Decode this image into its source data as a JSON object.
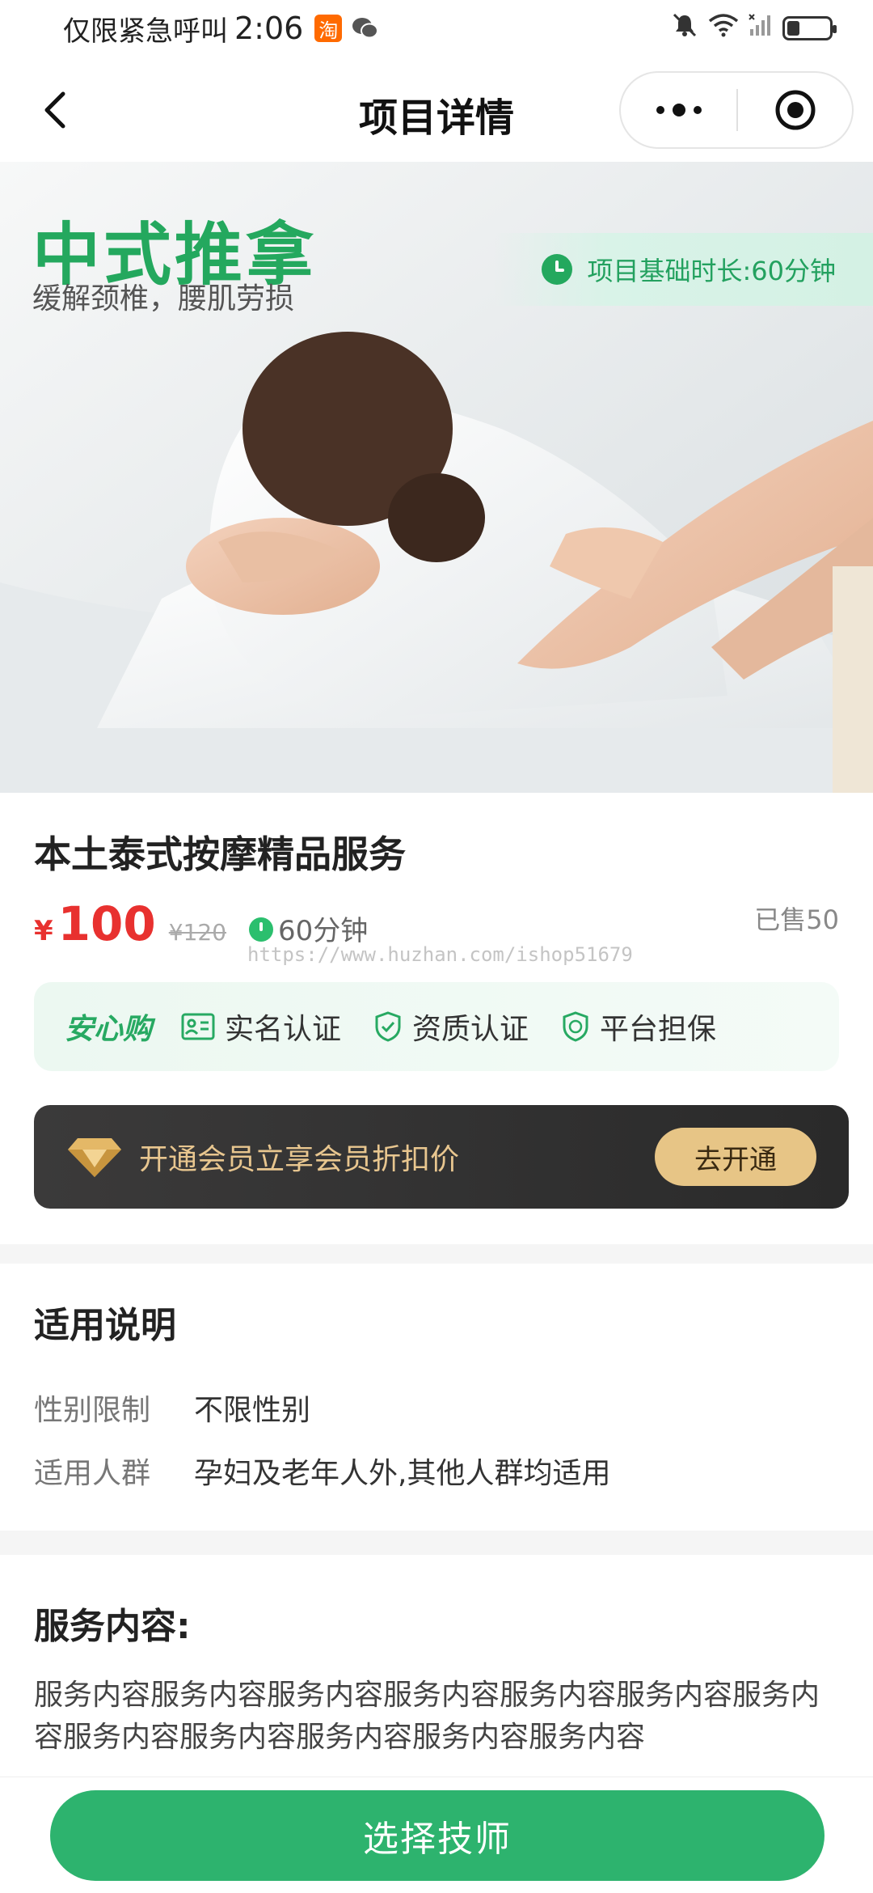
{
  "status_bar": {
    "carrier": "仅限紧急呼叫",
    "time": "2:06",
    "taobao_badge": "淘",
    "battery_level": 0.3
  },
  "nav": {
    "title": "项目详情"
  },
  "banner": {
    "title": "中式推拿",
    "subtitle": "缓解颈椎，腰肌劳损",
    "duration_tag": "项目基础时长:60分钟"
  },
  "product": {
    "title": "本土泰式按摩精品服务",
    "currency": "¥",
    "price": "100",
    "original_price": "¥120",
    "duration": "60分钟",
    "sold": "已售50",
    "watermark": "https://www.huzhan.com/ishop51679"
  },
  "trust": {
    "brand": "安心购",
    "items": [
      {
        "label": "实名认证",
        "icon": "id-card-icon"
      },
      {
        "label": "资质认证",
        "icon": "shield-check-icon"
      },
      {
        "label": "平台担保",
        "icon": "guarantee-shield-icon"
      }
    ]
  },
  "vip": {
    "text": "开通会员立享会员折扣价",
    "button": "去开通",
    "icon": "diamond-icon"
  },
  "usage": {
    "heading": "适用说明",
    "rows": [
      {
        "label": "性别限制",
        "value": "不限性别"
      },
      {
        "label": "适用人群",
        "value": "孕妇及老年人外,其他人群均适用"
      }
    ]
  },
  "service": {
    "heading": "服务内容:",
    "text": "服务内容服务内容服务内容服务内容服务内容服务内容服务内容服务内容服务内容服务内容服务内容服务内容"
  },
  "bottom": {
    "button": "选择技师"
  },
  "colors": {
    "brand_green": "#2db36e",
    "price_red": "#e8312f",
    "vip_gold": "#e7c586",
    "vip_dark": "#2a2a2a"
  }
}
